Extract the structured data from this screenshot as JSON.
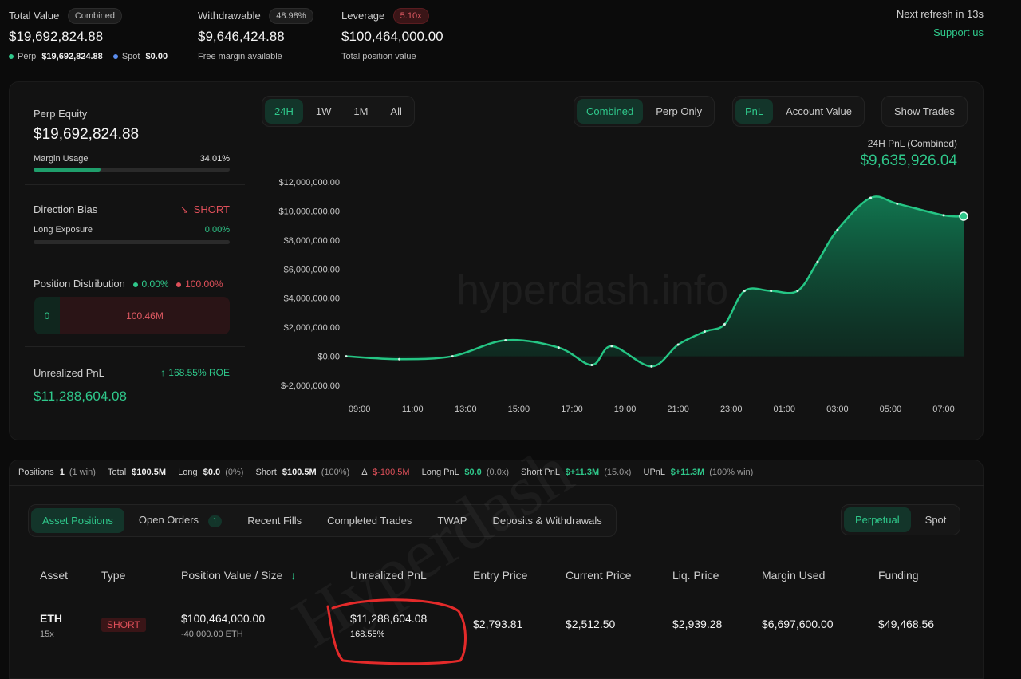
{
  "summary": {
    "total_value_label": "Total Value",
    "total_value_pill": "Combined",
    "total_value": "$19,692,824.88",
    "perp_label": "Perp",
    "perp_value": "$19,692,824.88",
    "spot_label": "Spot",
    "spot_value": "$0.00",
    "withdrawable_label": "Withdrawable",
    "withdrawable_pill": "48.98%",
    "withdrawable_value": "$9,646,424.88",
    "withdrawable_sub": "Free margin available",
    "leverage_label": "Leverage",
    "leverage_pill": "5.10x",
    "leverage_value": "$100,464,000.00",
    "leverage_sub": "Total position value",
    "refresh_text": "Next refresh in 13s",
    "support_link": "Support us"
  },
  "left_panel": {
    "perp_equity_label": "Perp Equity",
    "perp_equity_value": "$19,692,824.88",
    "margin_usage_label": "Margin Usage",
    "margin_usage_value": "34.01%",
    "margin_usage_fraction": 0.3401,
    "direction_bias_label": "Direction Bias",
    "direction_bias_value": "SHORT",
    "long_exposure_label": "Long Exposure",
    "long_exposure_value": "0.00%",
    "long_exposure_fraction": 0,
    "position_distribution_label": "Position Distribution",
    "dist_long_pct": "0.00%",
    "dist_short_pct": "100.00%",
    "dist_long_amount": "0",
    "dist_short_amount": "100.46M",
    "unrealized_pnl_label": "Unrealized PnL",
    "roe_text": "168.55% ROE",
    "unrealized_pnl_value": "$11,288,604.08"
  },
  "chart_controls": {
    "ranges": [
      "24H",
      "1W",
      "1M",
      "All"
    ],
    "active_range": "24H",
    "modes": [
      "Combined",
      "Perp Only"
    ],
    "active_mode": "Combined",
    "metrics": [
      "PnL",
      "Account Value"
    ],
    "active_metric": "PnL",
    "show_trades": "Show Trades",
    "pnl_label": "24H PnL (Combined)",
    "pnl_value": "$9,635,926.04",
    "watermark": "hyperdash.info"
  },
  "chart_data": {
    "type": "area",
    "title": "",
    "xlabel": "",
    "ylabel": "",
    "x_ticks": [
      "09:00",
      "11:00",
      "13:00",
      "15:00",
      "17:00",
      "19:00",
      "21:00",
      "23:00",
      "01:00",
      "03:00",
      "05:00",
      "07:00"
    ],
    "y_ticks": [
      "$12,000,000.00",
      "$10,000,000.00",
      "$8,000,000.00",
      "$6,000,000.00",
      "$4,000,000.00",
      "$2,000,000.00",
      "$0.00",
      "$-2,000,000.00"
    ],
    "ylim": [
      -2000000,
      12000000
    ],
    "xlim": [
      8.5,
      7.75
    ],
    "series": [
      {
        "x": [
          8.5,
          10.5,
          12.5,
          14.5,
          16.5,
          17.75,
          18.5,
          20.0,
          21.0,
          22.0,
          22.75,
          23.5,
          0.5,
          1.5,
          2.25,
          3.0,
          4.25,
          5.25,
          7.0,
          7.75
        ],
        "values": [
          0,
          -200000,
          0,
          1100000,
          600000,
          -600000,
          700000,
          -700000,
          800000,
          1700000,
          2200000,
          4500000,
          4500000,
          4500000,
          6500000,
          8700000,
          10900000,
          10500000,
          9700000,
          9635926
        ]
      }
    ],
    "colors": {
      "line": "#25c584",
      "fill": "#0f5a3d"
    },
    "grid": false
  },
  "stats_bar": {
    "positions_label": "Positions",
    "positions_value": "1",
    "positions_note": "(1 win)",
    "total_label": "Total",
    "total_value": "$100.5M",
    "long_label": "Long",
    "long_value": "$0.0",
    "long_note": "(0%)",
    "short_label": "Short",
    "short_value": "$100.5M",
    "short_note": "(100%)",
    "delta_label": "Δ",
    "delta_value": "$-100.5M",
    "long_pnl_label": "Long PnL",
    "long_pnl_value": "$0.0",
    "long_pnl_note": "(0.0x)",
    "short_pnl_label": "Short PnL",
    "short_pnl_value": "$+11.3M",
    "short_pnl_note": "(15.0x)",
    "upnl_label": "UPnL",
    "upnl_value": "$+11.3M",
    "upnl_note": "(100% win)"
  },
  "tabs": {
    "items": [
      "Asset Positions",
      "Open Orders",
      "Recent Fills",
      "Completed Trades",
      "TWAP",
      "Deposits & Withdrawals"
    ],
    "open_orders_badge": "1",
    "market_types": [
      "Perpetual",
      "Spot"
    ]
  },
  "table": {
    "headers": [
      "Asset",
      "Type",
      "Position Value / Size",
      "Unrealized PnL",
      "Entry Price",
      "Current Price",
      "Liq. Price",
      "Margin Used",
      "Funding"
    ],
    "sort_icon": "↓",
    "rows": [
      {
        "asset": "ETH",
        "leverage": "15x",
        "type": "SHORT",
        "position_value": "$100,464,000.00",
        "size": "-40,000.00 ETH",
        "unrealized_pnl": "$11,288,604.08",
        "pnl_pct": "168.55%",
        "entry_price": "$2,793.81",
        "current_price": "$2,512.50",
        "liq_price": "$2,939.28",
        "margin_used": "$6,697,600.00",
        "funding": "$49,468.56"
      }
    ],
    "watermark": "Hyperdash"
  }
}
